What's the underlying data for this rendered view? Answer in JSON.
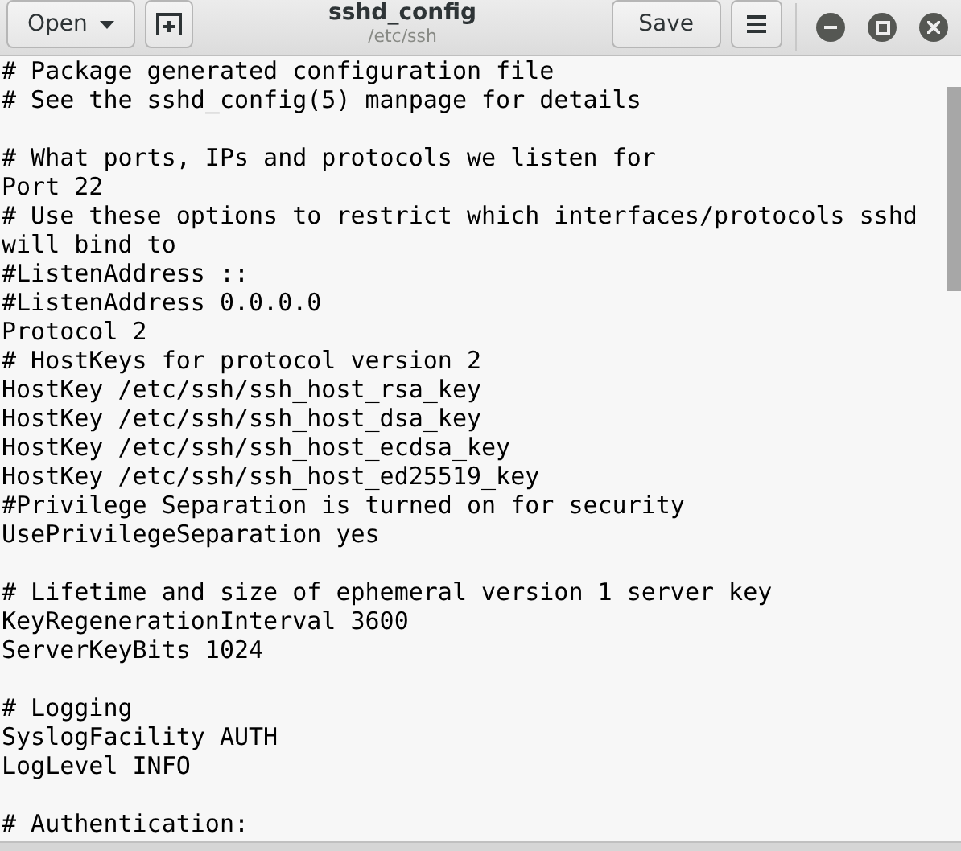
{
  "header": {
    "open_button": "Open",
    "title": "sshd_config",
    "subtitle": "/etc/ssh",
    "save_button": "Save"
  },
  "editor": {
    "blocks": [
      [
        "# Package generated configuration file",
        "# See the sshd_config(5) manpage for details"
      ],
      [
        "# What ports, IPs and protocols we listen for",
        "Port 22",
        "# Use these options to restrict which interfaces/protocols sshd",
        "will bind to",
        "#ListenAddress ::",
        "#ListenAddress 0.0.0.0",
        "Protocol 2",
        "# HostKeys for protocol version 2",
        "HostKey /etc/ssh/ssh_host_rsa_key",
        "HostKey /etc/ssh/ssh_host_dsa_key",
        "HostKey /etc/ssh/ssh_host_ecdsa_key",
        "HostKey /etc/ssh/ssh_host_ed25519_key",
        "#Privilege Separation is turned on for security",
        "UsePrivilegeSeparation yes"
      ],
      [
        "# Lifetime and size of ephemeral version 1 server key",
        "KeyRegenerationInterval 3600",
        "ServerKeyBits 1024"
      ],
      [
        "# Logging",
        "SyslogFacility AUTH",
        "LogLevel INFO"
      ],
      [
        "# Authentication:"
      ]
    ]
  }
}
